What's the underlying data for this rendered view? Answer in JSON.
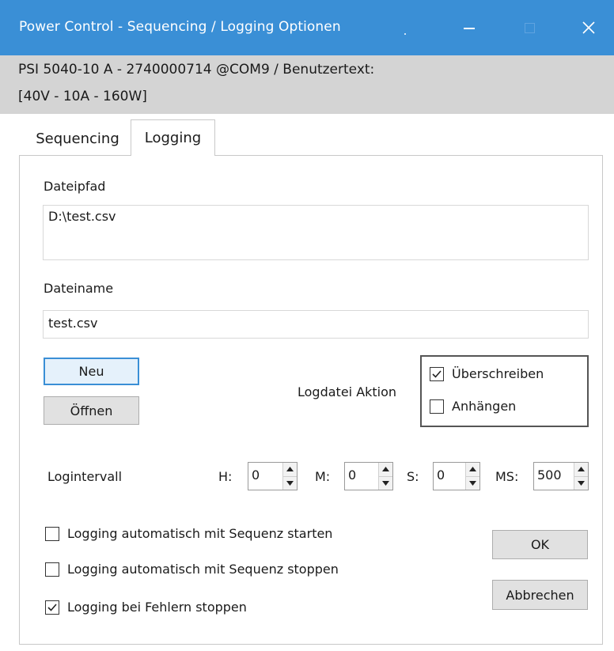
{
  "window": {
    "title": "Power Control - Sequencing / Logging Optionen"
  },
  "device": {
    "line1": "PSI 5040-10 A - 2740000714 @COM9 / Benutzertext:",
    "line2": "[40V - 10A - 160W]"
  },
  "tabs": [
    {
      "label": "Sequencing",
      "active": false
    },
    {
      "label": "Logging",
      "active": true
    }
  ],
  "logging": {
    "filepath_label": "Dateipfad",
    "filepath_value": "D:\\test.csv",
    "filename_label": "Dateiname",
    "filename_value": "test.csv",
    "new_button": "Neu",
    "open_button": "Öffnen",
    "action_label": "Logdatei Aktion",
    "overwrite_label": "Überschreiben",
    "overwrite_checked": true,
    "append_label": "Anhängen",
    "append_checked": false,
    "interval_label": "Logintervall",
    "h_label": "H:",
    "h_value": "0",
    "m_label": "M:",
    "m_value": "0",
    "s_label": "S:",
    "s_value": "0",
    "ms_label": "MS:",
    "ms_value": "500",
    "auto_start_label": "Logging automatisch mit Sequenz starten",
    "auto_start_checked": false,
    "auto_stop_label": "Logging automatisch mit Sequenz stoppen",
    "auto_stop_checked": false,
    "error_stop_label": "Logging bei Fehlern stoppen",
    "error_stop_checked": true,
    "ok_button": "OK",
    "cancel_button": "Abbrechen"
  },
  "colors": {
    "titlebar": "#3a8fd6",
    "infobar": "#d4d4d4",
    "default_button_border": "#3a8fd6"
  }
}
